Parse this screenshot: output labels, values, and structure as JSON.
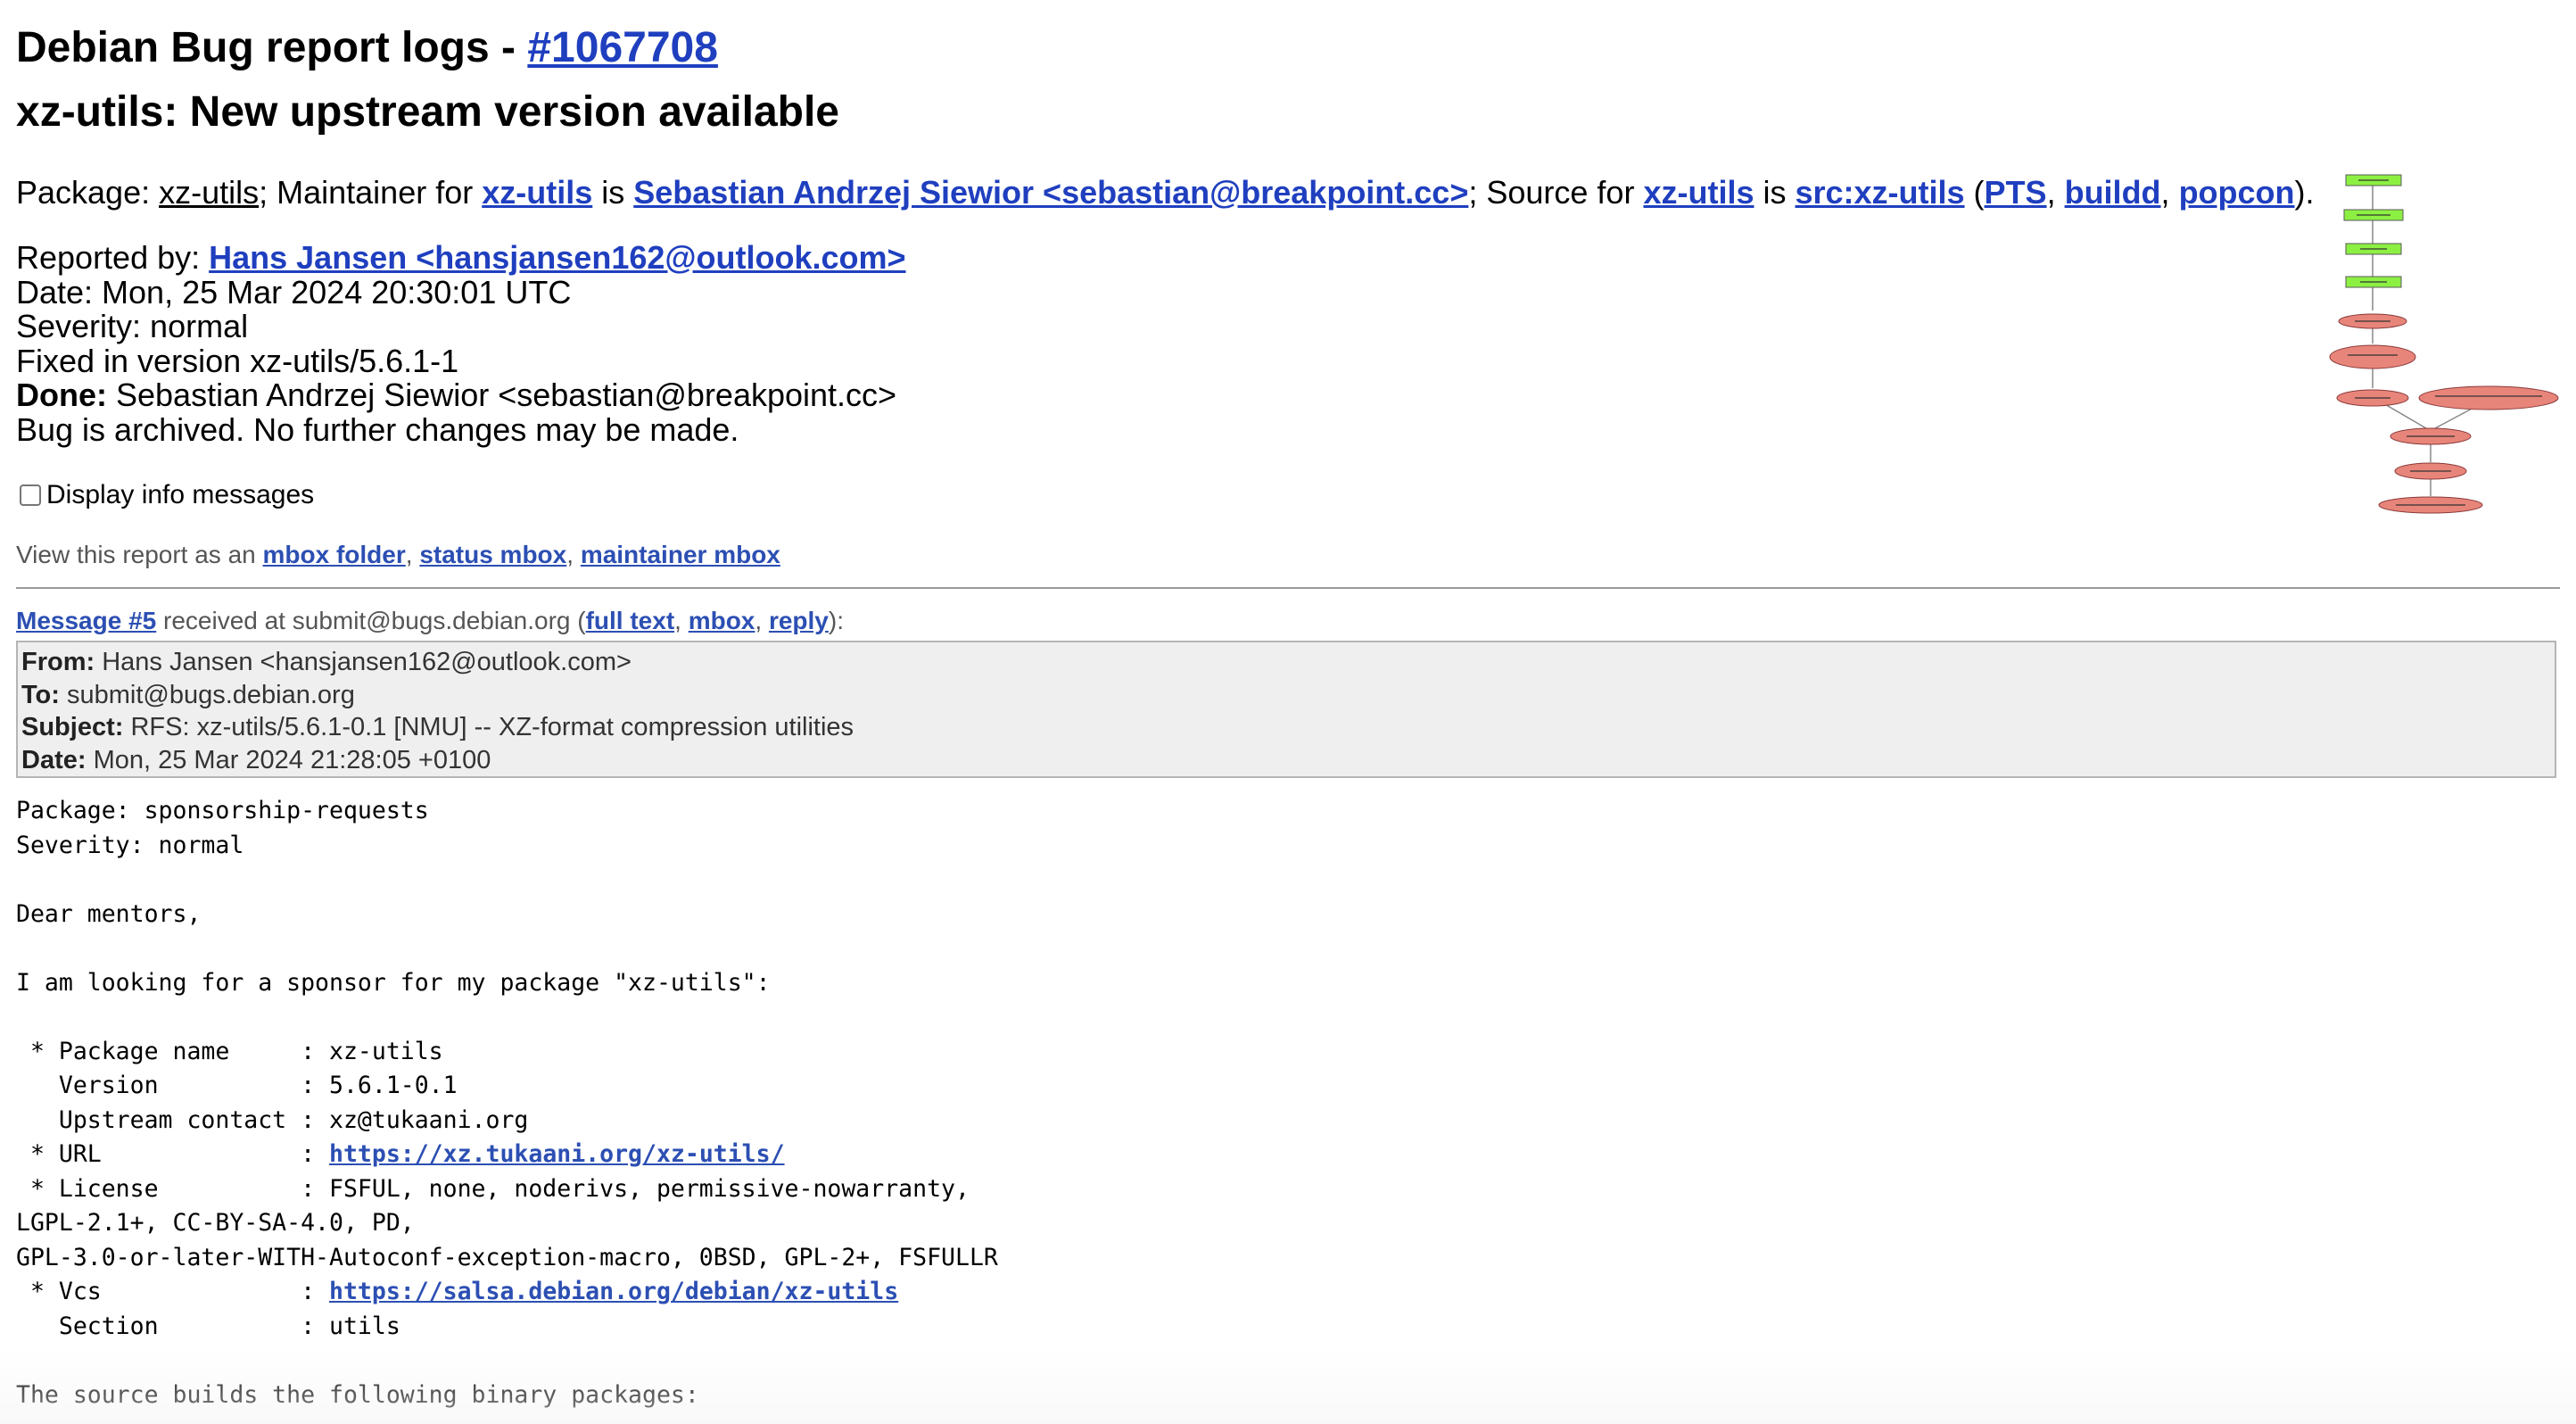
{
  "title": {
    "prefix": "Debian Bug report logs - ",
    "bug_link": "#1067708"
  },
  "subtitle": "xz-utils: New upstream version available",
  "package_line": {
    "package_label": "Package: ",
    "package": "xz-utils",
    "maint_text": "; Maintainer for ",
    "maint_pkg": "xz-utils",
    "is1": " is ",
    "maintainer": "Sebastian Andrzej Siewior <sebastian@breakpoint.cc>",
    "source_text": "; Source for ",
    "source_pkg": "xz-utils",
    "is2": " is ",
    "source": "src:xz-utils",
    "paren_open": " (",
    "pts": "PTS",
    "comma1": ", ",
    "buildd": "buildd",
    "comma2": ", ",
    "popcon": "popcon",
    "paren_close": ")."
  },
  "info": {
    "reported_label": "Reported by: ",
    "reported_by": "Hans Jansen <hansjansen162@outlook.com>",
    "date": "Date: Mon, 25 Mar 2024 20:30:01 UTC",
    "severity": "Severity: normal",
    "fixed": "Fixed in version xz-utils/5.6.1-1",
    "done_label": "Done:",
    "done_value": " Sebastian Andrzej Siewior <sebastian@breakpoint.cc>",
    "archived": "Bug is archived. No further changes may be made."
  },
  "display_info_label": "Display info messages",
  "view": {
    "prefix": "View this report as an ",
    "mbox_folder": "mbox folder",
    "sep1": ", ",
    "status_mbox": "status mbox",
    "sep2": ", ",
    "maintainer_mbox": "maintainer mbox"
  },
  "message": {
    "link": "Message #5",
    "received": " received at submit@bugs.debian.org (",
    "full_text": "full text",
    "sep1": ", ",
    "mbox": "mbox",
    "sep2": ", ",
    "reply": "reply",
    "end": "):"
  },
  "headers": {
    "from_label": "From:",
    "from": " Hans Jansen <hansjansen162@outlook.com>",
    "to_label": "To:",
    "to": " submit@bugs.debian.org",
    "subject_label": "Subject:",
    "subject": " RFS: xz-utils/5.6.1-0.1 [NMU] -- XZ-format compression utilities",
    "date_label": "Date:",
    "date": " Mon, 25 Mar 2024 21:28:05 +0100"
  },
  "body": {
    "l1": "Package: sponsorship-requests",
    "l2": "Severity: normal",
    "l3": "Dear mentors,",
    "l4": "I am looking for a sponsor for my package \"xz-utils\":",
    "l5": " * Package name     : xz-utils",
    "l6": "   Version          : 5.6.1-0.1",
    "l7": "   Upstream contact : xz@tukaani.org",
    "l8_prefix": " * URL              : ",
    "url": "https://xz.tukaani.org/xz-utils/",
    "l9": " * License          : FSFUL, none, noderivs, permissive-nowarranty,",
    "l10": "LGPL-2.1+, CC-BY-SA-4.0, PD,",
    "l11": "GPL-3.0-or-later-WITH-Autoconf-exception-macro, 0BSD, GPL-2+, FSFULLR",
    "l12_prefix": " * Vcs              : ",
    "vcs": "https://salsa.debian.org/debian/xz-utils",
    "l13": "   Section          : utils",
    "l14": "The source builds the following binary packages:"
  },
  "graph_colors": {
    "green": "#8cf043",
    "red": "#e8857a"
  }
}
